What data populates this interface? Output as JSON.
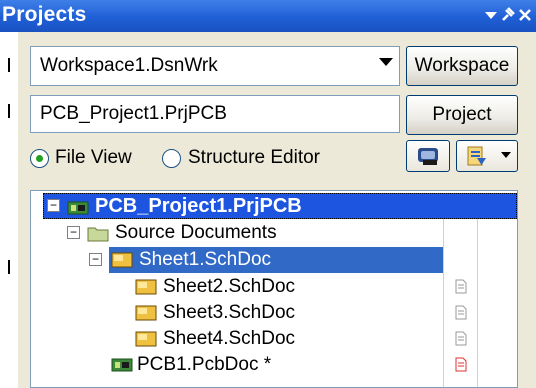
{
  "panel": {
    "title": "Projects",
    "controls": [
      "dropdown-icon",
      "pin-icon",
      "close-icon"
    ]
  },
  "workspace": {
    "combo_value": "Workspace1.DsnWrk",
    "button_label": "Workspace"
  },
  "project": {
    "field_value": "PCB_Project1.PrjPCB",
    "button_label": "Project"
  },
  "view_mode": {
    "options": [
      "File View",
      "Structure Editor"
    ],
    "selected": "File View"
  },
  "tree": {
    "project": "PCB_Project1.PrjPCB",
    "folder": "Source Documents",
    "items": [
      {
        "label": "Sheet1.SchDoc",
        "selected": true
      },
      {
        "label": "Sheet2.SchDoc",
        "selected": false
      },
      {
        "label": "Sheet3.SchDoc",
        "selected": false
      },
      {
        "label": "Sheet4.SchDoc",
        "selected": false
      },
      {
        "label": "PCB1.PcbDoc *",
        "selected": false
      }
    ]
  },
  "colors": {
    "title_bar": "#1f5fd6",
    "selection": "#3169c6",
    "modified_doc": "#e03030"
  }
}
